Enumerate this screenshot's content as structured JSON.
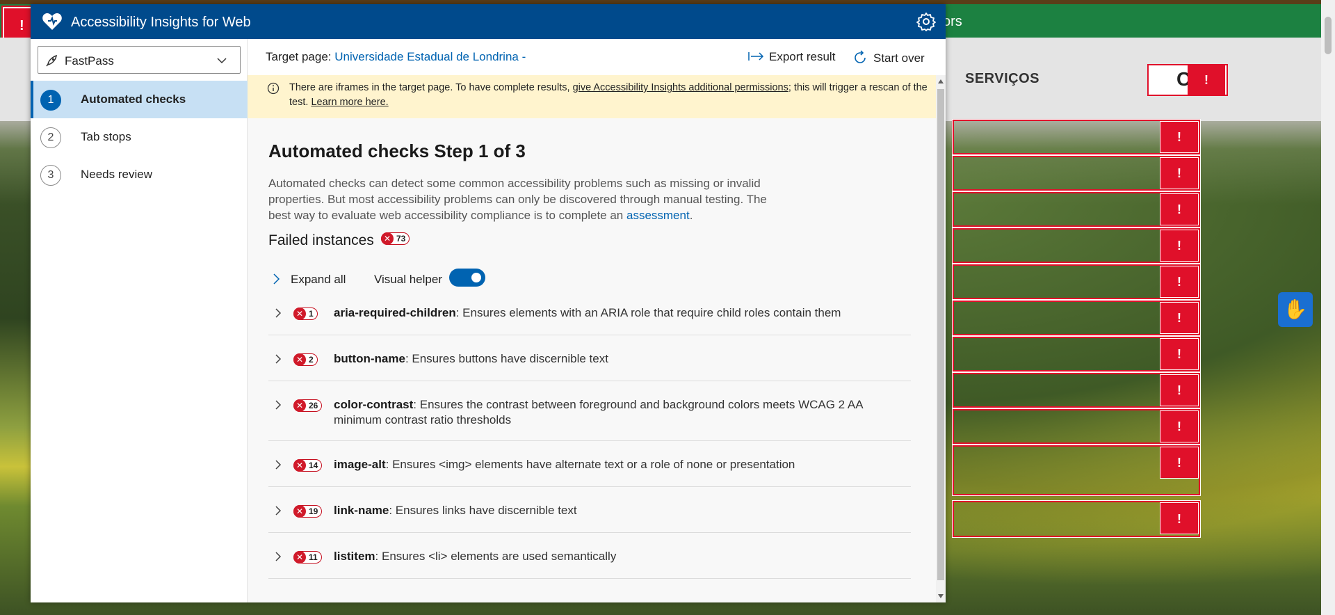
{
  "background": {
    "green_bar_text": "ors",
    "nav_label": "SERVIÇOS",
    "error_marker": "!",
    "search_glyph": "C"
  },
  "app": {
    "title": "Accessibility Insights for Web",
    "icons": {
      "logo": "heart-logo-icon",
      "settings": "gear-icon"
    }
  },
  "sidebar": {
    "mode_selector": {
      "value": "FastPass",
      "icon": "rocket-icon"
    },
    "items": [
      {
        "number": "1",
        "label": "Automated checks",
        "active": true
      },
      {
        "number": "2",
        "label": "Tab stops",
        "active": false
      },
      {
        "number": "3",
        "label": "Needs review",
        "active": false
      }
    ]
  },
  "command_bar": {
    "target_label": "Target page: ",
    "target_link": "Universidade Estadual de Londrina -",
    "export_label": "Export result",
    "start_over_label": "Start over"
  },
  "notice": {
    "text_before": "There are iframes in the target page. To have complete results, ",
    "link1": "give Accessibility Insights additional permissions",
    "text_middle": "; this will trigger a rescan of the test. ",
    "link2": "Learn more here."
  },
  "content": {
    "heading": "Automated checks Step 1 of 3",
    "description_before": "Automated checks can detect some common accessibility problems such as missing or invalid properties. But most accessibility problems can only be discovered through manual testing. The best way to evaluate web accessibility compliance is to complete an ",
    "description_link": "assessment",
    "description_after": ".",
    "failed_label": "Failed instances",
    "failed_count": "73",
    "expand_all_label": "Expand all",
    "visual_helper_label": "Visual helper",
    "visual_helper_on": true,
    "rules": [
      {
        "count": "1",
        "name": "aria-required-children",
        "description": ": Ensures elements with an ARIA role that require child roles contain them"
      },
      {
        "count": "2",
        "name": "button-name",
        "description": ": Ensures buttons have discernible text"
      },
      {
        "count": "26",
        "name": "color-contrast",
        "description": ": Ensures the contrast between foreground and background colors meets WCAG 2 AA minimum contrast ratio thresholds"
      },
      {
        "count": "14",
        "name": "image-alt",
        "description": ": Ensures <img> elements have alternate text or a role of none or presentation"
      },
      {
        "count": "19",
        "name": "link-name",
        "description": ": Ensures links have discernible text"
      },
      {
        "count": "11",
        "name": "listitem",
        "description": ": Ensures <li> elements are used semantically"
      }
    ]
  },
  "colors": {
    "title_bar": "#004a8c",
    "accent": "#0063b1",
    "error": "#d01a2a",
    "notice_bg": "#fff4ce",
    "site_green": "#1c8141"
  }
}
